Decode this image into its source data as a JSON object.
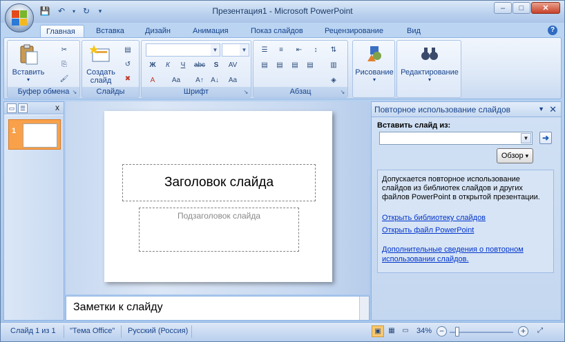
{
  "window": {
    "title": "Презентация1 - Microsoft PowerPoint",
    "minimize": "–",
    "maximize": "□",
    "close": "✕"
  },
  "qat": {
    "save": "💾",
    "undo": "↶",
    "undo_dd": "▾",
    "redo": "↻",
    "customize": "▾"
  },
  "tabs": [
    "Главная",
    "Вставка",
    "Дизайн",
    "Анимация",
    "Показ слайдов",
    "Рецензирование",
    "Вид"
  ],
  "help": "?",
  "ribbon": {
    "clipboard": {
      "paste": "Вставить",
      "paste_arrow": "▾",
      "label": "Буфер обмена",
      "cut": "✂",
      "copy": "⎘",
      "format": "🖌"
    },
    "slides": {
      "new_slide": "Создать слайд",
      "new_arrow": "▾",
      "label": "Слайды",
      "layout": "▤",
      "reset": "↺",
      "delete": "✖"
    },
    "font": {
      "label": "Шрифт",
      "bold": "Ж",
      "italic": "К",
      "underline": "Ч",
      "strike": "abc",
      "shadow": "S",
      "spacing": "AV",
      "grow": "A↑",
      "shrink": "A↓",
      "clear": "Aa",
      "color": "A",
      "case": "Aa"
    },
    "paragraph": {
      "label": "Абзац"
    },
    "drawing": {
      "label": "Рисование",
      "arrow": "▾"
    },
    "editing": {
      "label": "Редактирование",
      "arrow": "▾"
    }
  },
  "left_pane": {
    "close": "x",
    "slide_num": "1"
  },
  "slide": {
    "title_placeholder": "Заголовок слайда",
    "subtitle_placeholder": "Подзаголовок слайда"
  },
  "notes": {
    "placeholder": "Заметки к слайду"
  },
  "task_pane": {
    "title": "Повторное использование слайдов",
    "dropdown": "▼",
    "close": "✕",
    "insert_label": "Вставить слайд из:",
    "input_value": "",
    "browse": "Обзор",
    "browse_arrow": "▾",
    "go": "➜",
    "info": "Допускается повторное использование слайдов из библиотек слайдов и других файлов PowerPoint в открытой презентации.",
    "link_library": "Открыть библиотеку слайдов",
    "link_file": "Открыть файл PowerPoint",
    "link_more": "Дополнительные сведения о повторном использовании слайдов."
  },
  "status": {
    "slide": "Слайд 1 из 1",
    "theme": "\"Тема Office\"",
    "lang": "Русский (Россия)",
    "zoom": "34%",
    "zoom_out": "−",
    "zoom_in": "+",
    "zoom_level": 0.34
  }
}
